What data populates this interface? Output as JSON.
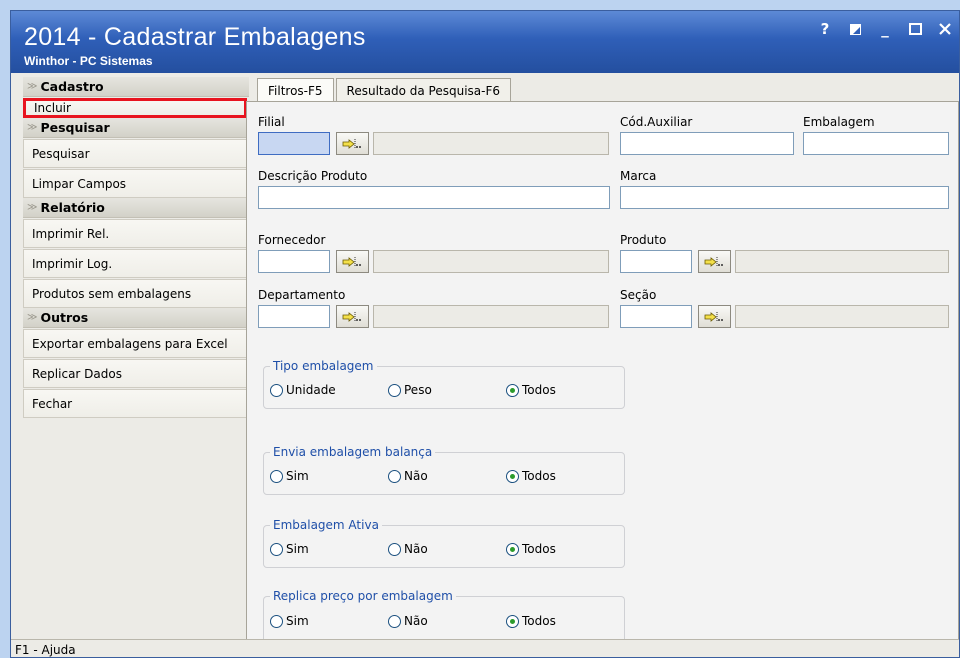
{
  "window": {
    "title": "2014 - Cadastrar Embalagens",
    "subtitle": "Winthor - PC Sistemas",
    "controls": [
      "help-icon",
      "restore-icon",
      "minimize-icon",
      "maximize-icon",
      "close-icon"
    ],
    "help_glyph": "?",
    "minimize_glyph": "_"
  },
  "sidebar": {
    "sections": [
      {
        "title": "Cadastro",
        "items": [
          "Incluir"
        ]
      },
      {
        "title": "Pesquisar",
        "items": [
          "Pesquisar",
          "Limpar Campos"
        ]
      },
      {
        "title": "Relatório",
        "items": [
          "Imprimir Rel.",
          "Imprimir Log.",
          "Produtos sem embalagens"
        ]
      },
      {
        "title": "Outros",
        "items": [
          "Exportar embalagens para Excel",
          "Replicar Dados",
          "Fechar"
        ]
      }
    ],
    "highlighted_item": "Incluir"
  },
  "tabs": [
    {
      "label": "Filtros-F5",
      "active": true
    },
    {
      "label": "Resultado da Pesquisa-F6",
      "active": false
    }
  ],
  "filters": {
    "filial_label": "Filial",
    "cod_auxiliar_label": "Cód.Auxiliar",
    "embalagem_label": "Embalagem",
    "descricao_label": "Descrição Produto",
    "marca_label": "Marca",
    "fornecedor_label": "Fornecedor",
    "produto_label": "Produto",
    "departamento_label": "Departamento",
    "secao_label": "Seção"
  },
  "groups": [
    {
      "title": "Tipo embalagem",
      "options": [
        "Unidade",
        "Peso",
        "Todos"
      ],
      "selected": "Todos"
    },
    {
      "title": "Envia embalagem balança",
      "options": [
        "Sim",
        "Não",
        "Todos"
      ],
      "selected": "Todos"
    },
    {
      "title": "Embalagem Ativa",
      "options": [
        "Sim",
        "Não",
        "Todos"
      ],
      "selected": "Todos"
    },
    {
      "title": "Replica preço por embalagem",
      "options": [
        "Sim",
        "Não",
        "Todos"
      ],
      "selected": "Todos"
    }
  ],
  "statusbar": {
    "text": "F1 - Ajuda"
  },
  "colors": {
    "titlebar": "#2f5fb8",
    "highlight_border": "#e8141f",
    "group_title": "#1f4fa8",
    "radio_dot": "#2c9b2c"
  }
}
